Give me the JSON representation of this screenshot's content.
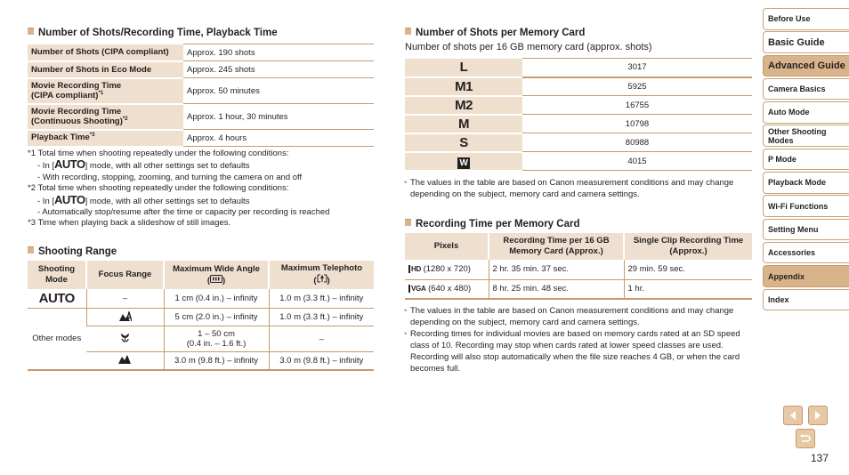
{
  "battery": {
    "title": "Number of Shots/Recording Time, Playback Time",
    "rows": [
      {
        "label": "Number of Shots (CIPA compliant)",
        "sup": "",
        "value": "Approx. 190 shots"
      },
      {
        "label": "Number of Shots in Eco Mode",
        "sup": "",
        "value": "Approx. 245 shots"
      },
      {
        "label": "Movie Recording Time",
        "label2": "(CIPA compliant)",
        "sup": "*1",
        "value": "Approx. 50 minutes"
      },
      {
        "label": "Movie Recording Time",
        "label2": "(Continuous Shooting)",
        "sup": "*2",
        "value": "Approx. 1 hour, 30 minutes"
      },
      {
        "label": "Playback Time",
        "sup": "*3",
        "value": "Approx. 4 hours"
      }
    ],
    "notes": {
      "n1": "*1 Total time when shooting repeatedly under the following conditions:",
      "n1a_pre": "- In [",
      "n1a_post": "] mode, with all other settings set to defaults",
      "n1b": "- With recording, stopping, zooming, and turning the camera on and off",
      "n2": "*2 Total time when shooting repeatedly under the following conditions:",
      "n2a_pre": "- In [",
      "n2a_post": "] mode, with all other settings set to defaults",
      "n2b": "- Automatically stop/resume after the time or capacity per recording is reached",
      "n3": "*3 Time when playing back a slideshow of still images.",
      "auto_glyph": "AUTO"
    }
  },
  "range": {
    "title": "Shooting Range",
    "headers": [
      "Shooting Mode",
      "Focus Range",
      "Maximum Wide Angle",
      "Maximum Telephoto"
    ],
    "rows": [
      {
        "mode": "AUTO",
        "focus": "–",
        "wide": "1 cm (0.4 in.) – infinity",
        "tele": "1.0 m (3.3 ft.) – infinity"
      },
      {
        "mode": "Other modes",
        "focus": "auto-macro",
        "wide": "5 cm (2.0 in.) – infinity",
        "tele": "1.0 m (3.3 ft.) – infinity"
      },
      {
        "focus": "macro",
        "wide": "1 – 50 cm",
        "wide2": "(0.4 in. – 1.6 ft.)",
        "tele": "–"
      },
      {
        "focus": "infinity",
        "wide": "3.0 m (9.8 ft.) – infinity",
        "tele": "3.0 m (9.8 ft.) – infinity"
      }
    ]
  },
  "shots": {
    "title": "Number of Shots per Memory Card",
    "subtitle": "Number of shots per 16 GB memory card (approx. shots)",
    "rows": [
      {
        "size": "L",
        "value": "3017"
      },
      {
        "size": "M1",
        "value": "5925"
      },
      {
        "size": "M2",
        "value": "16755"
      },
      {
        "size": "M",
        "value": "10798"
      },
      {
        "size": "S",
        "value": "80988"
      },
      {
        "size": "W",
        "value": "4015"
      }
    ],
    "note": "The values in the table are based on Canon measurement conditions and may change depending on the subject, memory card and camera settings."
  },
  "recording": {
    "title": "Recording Time per Memory Card",
    "headers": [
      "Pixels",
      "Recording Time per 16 GB Memory Card (Approx.)",
      "Single Clip Recording Time (Approx.)"
    ],
    "rows": [
      {
        "icon": "HD",
        "pixels": "(1280 x 720)",
        "time": "2 hr. 35 min. 37 sec.",
        "clip": "29 min. 59 sec."
      },
      {
        "icon": "VGA",
        "pixels": "(640 x 480)",
        "time": "8 hr. 25 min. 48 sec.",
        "clip": "1 hr."
      }
    ],
    "notes": [
      "The values in the table are based on Canon measurement conditions and may change depending on the subject, memory card and camera settings.",
      "Recording times for individual movies are based on memory cards rated at an SD speed class of 10. Recording may stop when cards rated at lower speed classes are used. Recording will also stop automatically when the file size reaches 4 GB, or when the card becomes full."
    ]
  },
  "sidebar": {
    "items": [
      {
        "label": "Before Use"
      },
      {
        "label": "Basic Guide"
      },
      {
        "label": "Advanced Guide"
      },
      {
        "label": "Camera Basics"
      },
      {
        "label": "Auto Mode"
      },
      {
        "label": "Other Shooting Modes"
      },
      {
        "label": "P Mode"
      },
      {
        "label": "Playback Mode"
      },
      {
        "label": "Wi-Fi Functions"
      },
      {
        "label": "Setting Menu"
      },
      {
        "label": "Accessories"
      },
      {
        "label": "Appendix"
      },
      {
        "label": "Index"
      }
    ]
  },
  "nav": {
    "prev": "previous-page",
    "next": "next-page",
    "back": "return"
  },
  "page_number": "137",
  "colors": {
    "accent": "#d9b48a",
    "cell_bg": "#eedfcf",
    "rule": "#c49a6c",
    "bullet": "#d48a45"
  }
}
